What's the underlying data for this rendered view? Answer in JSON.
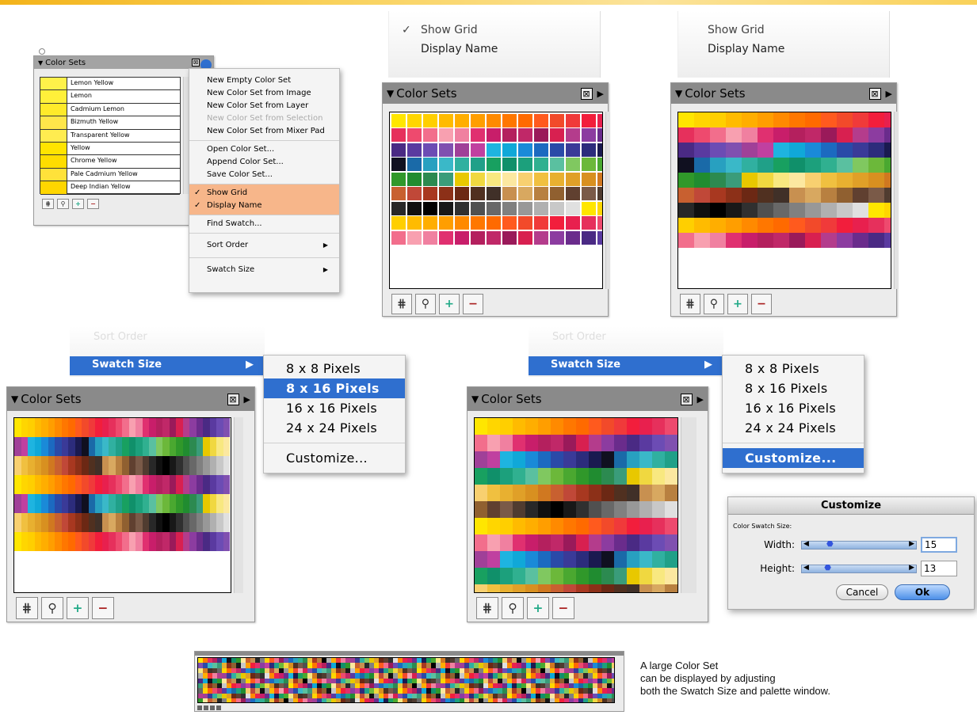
{
  "colors": {
    "accent": "#2f6fcf",
    "highlight": "#f7b68a",
    "palette_title_bar": "#8a8a8a"
  },
  "palette_title": "Color Sets",
  "palette_icons": [
    "swatch-options-icon",
    "find-binoculars-icon",
    "add-swatch-icon",
    "delete-swatch-icon"
  ],
  "panel1": {
    "swatch_names": [
      "Lemon Yellow",
      "Lemon",
      "Cadmium Lemon",
      "Bizmuth Yellow",
      "Transparent Yellow",
      "Yellow",
      "Chrome Yellow",
      "Pale Cadmium Yellow",
      "Deep Indian Yellow"
    ],
    "swatch_colors": [
      "#fff14a",
      "#fff03a",
      "#ffea2a",
      "#ffe64a",
      "#ffec50",
      "#ffe400",
      "#ffdd00",
      "#ffe23a",
      "#ffd600"
    ],
    "menu_groups": [
      [
        {
          "label": "New Empty Color Set"
        },
        {
          "label": "New Color Set from Image"
        },
        {
          "label": "New Color Set from Layer"
        },
        {
          "label": "New Color Set from Selection",
          "disabled": true
        },
        {
          "label": "New Color Set from Mixer Pad"
        }
      ],
      [
        {
          "label": "Open Color Set..."
        },
        {
          "label": "Append Color Set..."
        },
        {
          "label": "Save Color Set..."
        }
      ],
      [
        {
          "label": "Show Grid",
          "checked": true,
          "highlight": true
        },
        {
          "label": "Display Name",
          "checked": true,
          "highlight": true
        }
      ],
      [
        {
          "label": "Find Swatch..."
        }
      ],
      [
        {
          "label": "Sort Order",
          "submenu": true
        }
      ],
      [
        {
          "label": "Swatch Size",
          "submenu": true
        }
      ]
    ]
  },
  "panel2_menu": [
    {
      "label": "Show Grid",
      "checked": true
    },
    {
      "label": "Display Name"
    }
  ],
  "panel3_menu": [
    {
      "label": "Show Grid"
    },
    {
      "label": "Display Name"
    }
  ],
  "swatch_menu": {
    "faded_item": "Sort Order",
    "item": "Swatch Size"
  },
  "size_options": [
    "8 x 8 Pixels",
    "8 x 16 Pixels",
    "16 x 16 Pixels",
    "24 x 24 Pixels"
  ],
  "customize_label": "Customize...",
  "panel4_selected_size": "8 x 16 Pixels",
  "customize_dialog": {
    "title": "Customize",
    "group_label": "Color Swatch Size:",
    "width_label": "Width:",
    "width_value": "15",
    "width_level": 0.15,
    "height_label": "Height:",
    "height_value": "13",
    "height_level": 0.13,
    "cancel_label": "Cancel",
    "ok_label": "Ok"
  },
  "caption": [
    "A large Color Set",
    "can be displayed by adjusting",
    "both the Swatch Size and palette window."
  ]
}
